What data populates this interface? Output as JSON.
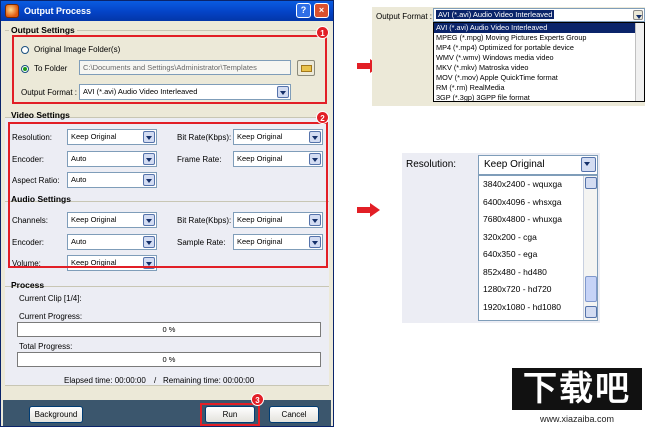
{
  "window": {
    "title": "Output Process",
    "help_glyph": "?",
    "close_glyph": "×"
  },
  "output_settings": {
    "heading": "Output Settings",
    "radio_original": "Original Image Folder(s)",
    "radio_to_folder": "To Folder",
    "folder_path": "C:\\Documents and Settings\\Administrator\\Templates",
    "output_format_label": "Output Format :",
    "output_format_value": "AVI  (*.avi) Audio Video Interleaved"
  },
  "video_settings": {
    "heading": "Video Settings",
    "resolution_label": "Resolution:",
    "resolution_value": "Keep Original",
    "bitrate_label": "Bit Rate(Kbps):",
    "bitrate_value": "Keep Original",
    "encoder_label": "Encoder:",
    "encoder_value": "Auto",
    "framerate_label": "Frame Rate:",
    "framerate_value": "Keep Original",
    "aspect_label": "Aspect Ratio:",
    "aspect_value": "Auto"
  },
  "audio_settings": {
    "heading": "Audio Settings",
    "channels_label": "Channels:",
    "channels_value": "Keep Original",
    "bitrate_label": "Bit Rate(Kbps):",
    "bitrate_value": "Keep Original",
    "encoder_label": "Encoder:",
    "encoder_value": "Auto",
    "samplerate_label": "Sample Rate:",
    "samplerate_value": "Keep Original",
    "volume_label": "Volume:",
    "volume_value": "Keep Original"
  },
  "process": {
    "heading": "Process",
    "current_clip": "Current Clip [1/4]:",
    "current_progress_label": "Current Progress:",
    "current_progress_value": "0 %",
    "total_progress_label": "Total Progress:",
    "total_progress_value": "0 %",
    "elapsed": "Elapsed time: 00:00:00",
    "separator": "/",
    "remaining": "Remaining time: 00:00:00"
  },
  "buttons": {
    "background": "Background",
    "run": "Run",
    "cancel": "Cancel"
  },
  "badges": {
    "one": "1",
    "two": "2",
    "three": "3"
  },
  "format_dropdown": {
    "label": "Output Format :",
    "value": "AVI  (*.avi) Audio Video Interleaved",
    "options": [
      "AVI  (*.avi) Audio Video Interleaved",
      "MPEG (*.mpg) Moving Pictures Experts Group",
      "MP4  (*.mp4) Optimized for portable device",
      "WMV  (*.wmv) Windows media video",
      "MKV  (*.mkv) Matroska video",
      "MOV  (*.mov) Apple QuickTime format",
      "RM   (*.rm) RealMedia",
      "3GP  (*.3gp) 3GPP file format"
    ]
  },
  "resolution_dropdown": {
    "label": "Resolution:",
    "value": "Keep Original",
    "options": [
      "3840x2400 - wquxga",
      "6400x4096 - whsxga",
      "7680x4800 - whuxga",
      "320x200 - cga",
      "640x350 - ega",
      "852x480 - hd480",
      "1280x720 - hd720",
      "1920x1080 - hd1080"
    ]
  },
  "watermark": {
    "logo": "下载吧",
    "url": "www.xiazaiba.com"
  },
  "colors": {
    "highlight_red": "#e21f26",
    "title_blue": "#0443c6",
    "selection_navy": "#0a246a",
    "bottom_bar": "#3b566d"
  }
}
